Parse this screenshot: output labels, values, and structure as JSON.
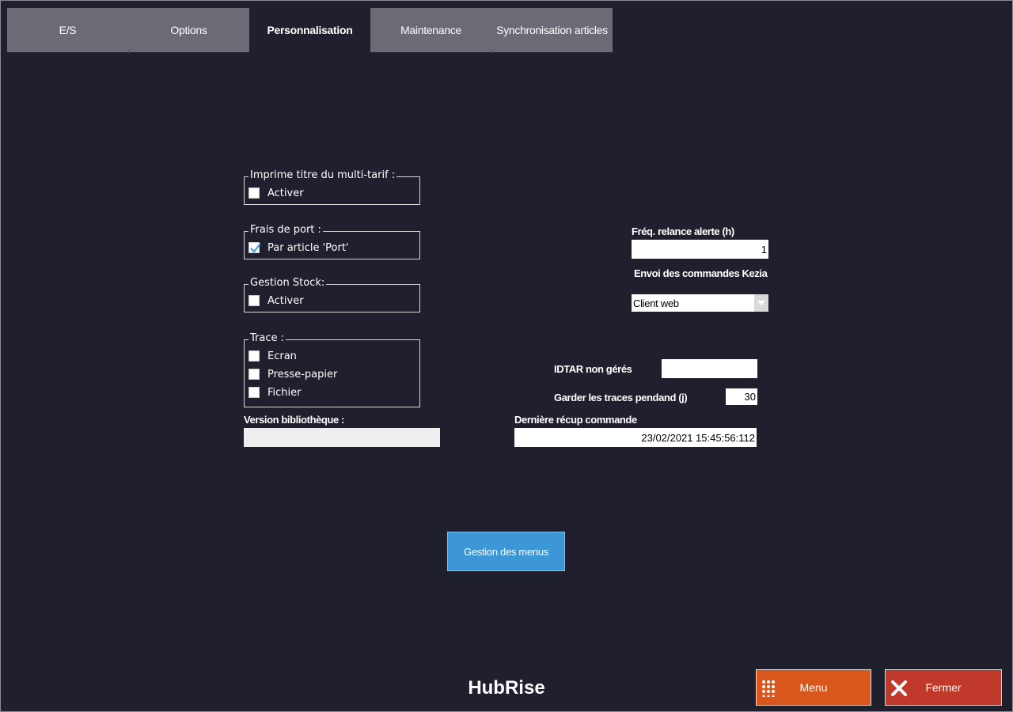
{
  "tabs": [
    {
      "label": "E/S",
      "active": false
    },
    {
      "label": "Options",
      "active": false
    },
    {
      "label": "Personnalisation",
      "active": true
    },
    {
      "label": "Maintenance",
      "active": false
    },
    {
      "label": "Synchronisation articles",
      "active": false
    }
  ],
  "groups": {
    "multitarif": {
      "title": "Imprime titre du multi-tarif :",
      "items": [
        {
          "label": "Activer",
          "checked": false
        }
      ]
    },
    "frais_port": {
      "title": "Frais de port :",
      "items": [
        {
          "label": "Par article 'Port'",
          "checked": true
        }
      ]
    },
    "gestion_stock": {
      "title": "Gestion Stock:",
      "items": [
        {
          "label": "Activer",
          "checked": false
        }
      ]
    },
    "trace": {
      "title": "Trace :",
      "items": [
        {
          "label": "Ecran",
          "checked": false
        },
        {
          "label": "Presse-papier",
          "checked": false
        },
        {
          "label": "Fichier",
          "checked": false
        }
      ]
    }
  },
  "version": {
    "label": "Version bibliothèque :",
    "value": ""
  },
  "freq_relance": {
    "label": "Fréq. relance alerte (h)",
    "value": "1"
  },
  "envoi_commandes": {
    "label": "Envoi des commandes Kezia",
    "selected": "Client web"
  },
  "idtar": {
    "label": "IDTAR non gérés",
    "value": ""
  },
  "garder_traces": {
    "label": "Garder les traces pendand (j)",
    "value": "30"
  },
  "derniere_recup": {
    "label": "Dernière récup commande",
    "value": "23/02/2021 15:45:56:112"
  },
  "gestion_menus_button": "Gestion des menus",
  "app_title": "HubRise",
  "bottom_buttons": {
    "menu": {
      "label": "Menu",
      "icon": "grid-icon",
      "color": "#d9561d"
    },
    "fermer": {
      "label": "Fermer",
      "icon": "close-icon",
      "color": "#c0392b"
    }
  },
  "colors": {
    "background": "#1f1f2e",
    "tab_inactive": "#6b6b76",
    "accent_blue": "#3d96d5",
    "check": "#3d96d5"
  }
}
